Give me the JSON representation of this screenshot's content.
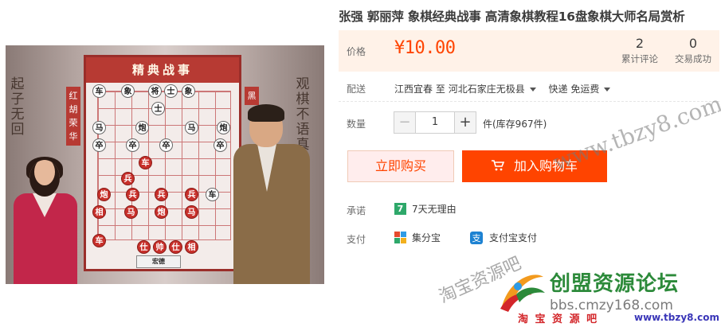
{
  "product": {
    "title": "张强 郭丽萍 象棋经典战事 高清象棋教程16盘象棋大师名局赏析",
    "image": {
      "board_title": "精典战事",
      "left_banner": "红胡荣华",
      "right_banner": "黑",
      "left_callig": "起子无回",
      "right_callig": "观棋不语真",
      "logo_text": "宏德"
    }
  },
  "pricing": {
    "label": "价格",
    "price": "¥10.00",
    "reviews_count": "2",
    "reviews_label": "累计评论",
    "sales_count": "0",
    "sales_label": "交易成功"
  },
  "shipping": {
    "label": "配送",
    "from": "江西宜春",
    "to_word": "至",
    "destination": "河北石家庄无极县",
    "method": "快递 免运费"
  },
  "quantity": {
    "label": "数量",
    "minus": "−",
    "value": "1",
    "plus": "+",
    "stock": "件(库存967件)"
  },
  "actions": {
    "buy_now": "立即购买",
    "add_to_cart": "加入购物车"
  },
  "promise": {
    "label": "承诺",
    "icon_text": "7",
    "text": "7天无理由"
  },
  "payment": {
    "label": "支付",
    "option1": "集分宝",
    "option2": "支付宝支付"
  },
  "watermarks": {
    "url_diagonal": "www.tbzy8.com",
    "taobao_diagonal": "淘宝资源吧",
    "brand_main": "创盟资源论坛",
    "brand_url": "bbs.cmzy168.com",
    "brand_sub": "淘 宝 资 源 吧",
    "brand_sub2": "www.tbzy8.com"
  },
  "colors": {
    "accent": "#ff4400",
    "price_bg": "#fff2e8",
    "buy_bg": "#ffeded",
    "promise_green": "#2ea86a",
    "brand_green": "#2c8a3a"
  }
}
